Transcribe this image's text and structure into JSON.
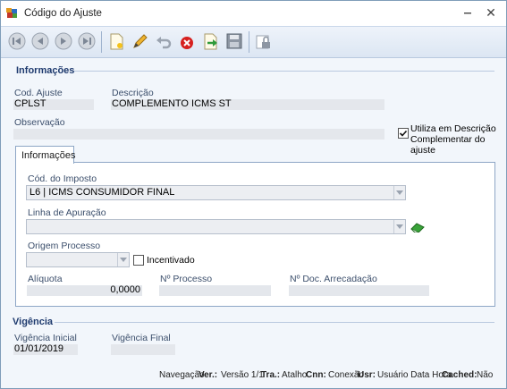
{
  "window": {
    "title": "Código do Ajuste"
  },
  "toolbar": {
    "buttons": [
      "first-record-icon",
      "previous-record-icon",
      "next-record-icon",
      "last-record-icon",
      "new-icon",
      "edit-icon",
      "undo-icon",
      "delete-icon",
      "redo-icon",
      "save-icon",
      "lock-icon"
    ]
  },
  "info_section": {
    "title": "Informações",
    "cod_ajuste_label": "Cod. Ajuste",
    "cod_ajuste_value": "CPLST",
    "descricao_label": "Descrição",
    "descricao_value": "COMPLEMENTO ICMS ST",
    "observacao_label": "Observação",
    "observacao_value": "",
    "utiliza_label_line1": "Utiliza em Descrição",
    "utiliza_label_line2": "Complementar do ajuste",
    "utiliza_checked": true
  },
  "tabs": {
    "active": "Informações"
  },
  "tab_info": {
    "cod_imposto_label": "Cód. do Imposto",
    "cod_imposto_value": "L6 | ICMS CONSUMIDOR FINAL",
    "linha_apuracao_label": "Linha de Apuração",
    "linha_apuracao_value": "",
    "origem_processo_label": "Origem Processo",
    "origem_processo_value": "",
    "incentivado_label": "Incentivado",
    "incentivado_checked": false,
    "aliquota_label": "Alíquota",
    "aliquota_value": "0,0000",
    "n_processo_label": "Nº Processo",
    "n_processo_value": "",
    "n_doc_label": "Nº Doc. Arrecadação",
    "n_doc_value": ""
  },
  "vigencia_section": {
    "title": "Vigência",
    "inicial_label": "Vigência Inicial",
    "inicial_value": "01/01/2019",
    "final_label": "Vigência Final",
    "final_value": ""
  },
  "status_bar": {
    "navegacao": "Navegação",
    "ver_key": "Ver.:",
    "ver_value": "Versão 1/1",
    "tra_key": "Tra.:",
    "tra_value": "Atalho",
    "cnn_key": "Cnn:",
    "cnn_value": "Conexão",
    "usr_key": "Usr:",
    "usr_value": "Usuário Data Hora",
    "cached_key": "Cached:",
    "cached_value": "Não"
  },
  "colors": {
    "accent": "#1e3a6e",
    "delete_red": "#d6201f",
    "frame": "#8da6c6"
  }
}
